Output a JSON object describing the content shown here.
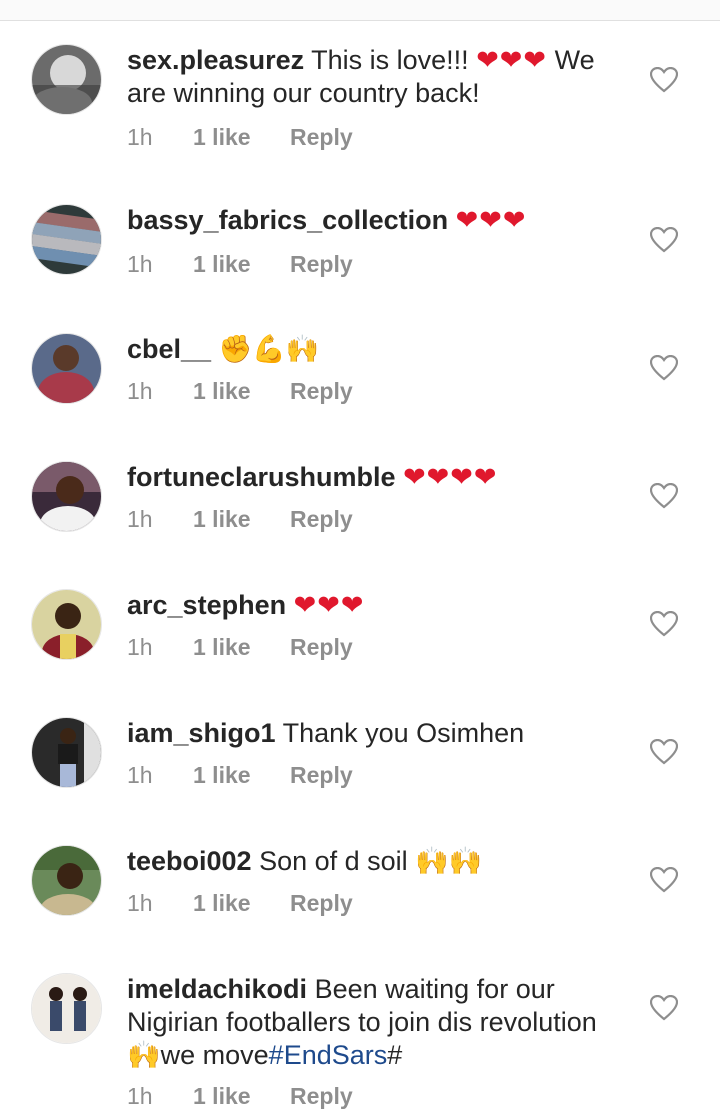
{
  "comments": [
    {
      "username": "sex.pleasurez",
      "text": "This is love!!!",
      "hearts": "❤❤❤",
      "text_after": "We are winning our country back!",
      "time": "1h",
      "likes": "1 like",
      "reply": "Reply"
    },
    {
      "username": "bassy_fabrics_collection",
      "hearts": "❤❤❤",
      "time": "1h",
      "likes": "1 like",
      "reply": "Reply"
    },
    {
      "username": "cbel__",
      "emojis": "✊💪🙌",
      "time": "1h",
      "likes": "1 like",
      "reply": "Reply"
    },
    {
      "username": "fortuneclarushumble",
      "hearts": "❤❤❤❤",
      "time": "1h",
      "likes": "1 like",
      "reply": "Reply"
    },
    {
      "username": "arc_stephen",
      "hearts": "❤❤❤",
      "time": "1h",
      "likes": "1 like",
      "reply": "Reply"
    },
    {
      "username": "iam_shigo1",
      "text": "Thank you Osimhen",
      "time": "1h",
      "likes": "1 like",
      "reply": "Reply"
    },
    {
      "username": "teeboi002",
      "text": "Son of d soil",
      "emojis": "🙌🙌",
      "time": "1h",
      "likes": "1 like",
      "reply": "Reply"
    },
    {
      "username": "imeldachikodi",
      "text": "Been waiting for our Nigirian footballers to join dis revolution",
      "emojis": "🙌",
      "text_after": "we move",
      "hashtag": "#EndSars",
      "text_end": "#",
      "time": "1h",
      "likes": "1 like",
      "reply": "Reply"
    }
  ],
  "icons": {
    "like": "heart-outline-icon"
  },
  "colors": {
    "heart_red": "#e0182d",
    "meta_gray": "#8e8e8e",
    "hashtag_blue": "#1e4a8c"
  }
}
